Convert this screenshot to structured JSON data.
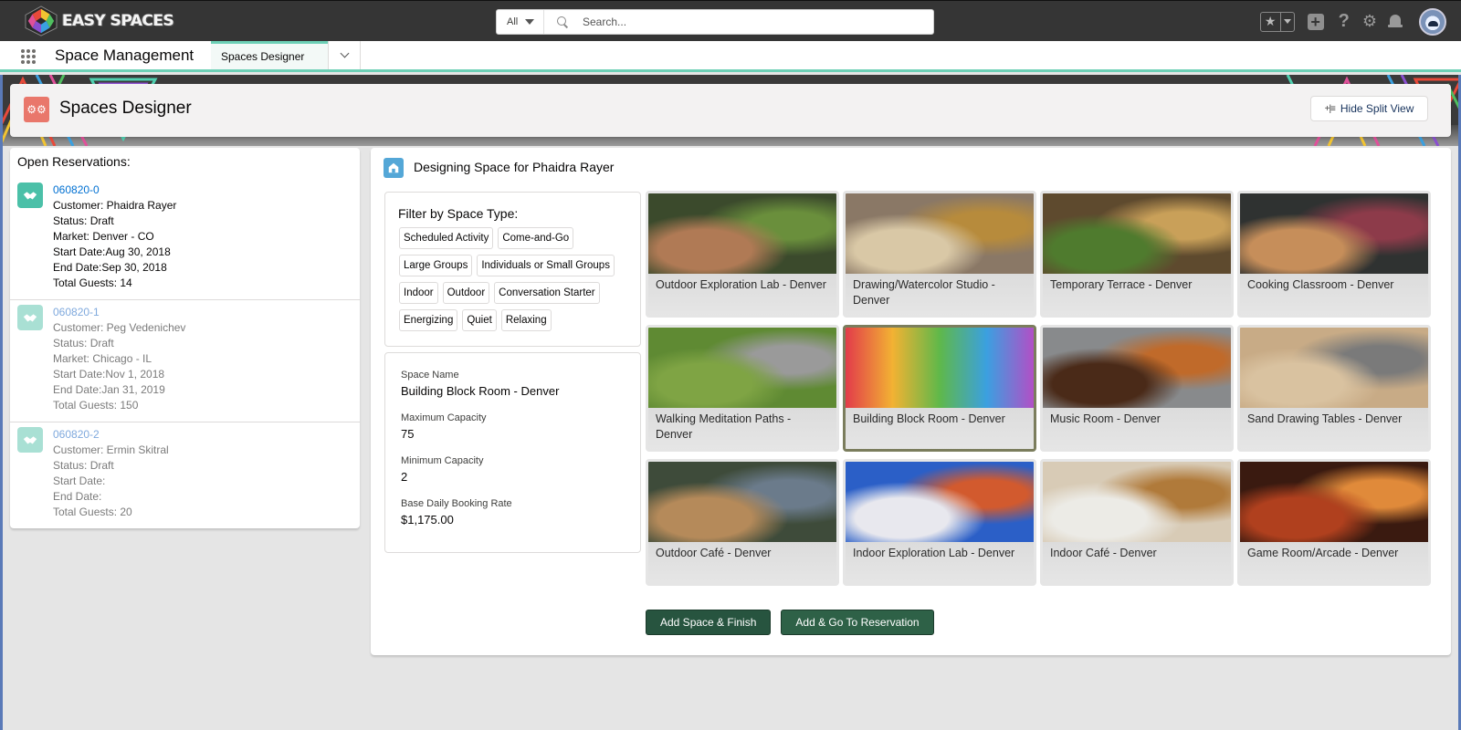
{
  "global_header": {
    "brand": "EASY SPACES",
    "search": {
      "scope": "All",
      "placeholder": "Search..."
    },
    "icons": [
      "favorites-star-icon",
      "favorites-dropdown-icon",
      "global-add-icon",
      "help-icon",
      "setup-gear-icon",
      "notifications-bell-icon",
      "user-avatar"
    ]
  },
  "app_nav": {
    "app_name": "Space Management",
    "tabs": [
      {
        "label": "Spaces Designer",
        "active": true
      }
    ]
  },
  "page_header": {
    "title": "Spaces Designer",
    "hide_split_view_label": "Hide Split View"
  },
  "reservations": {
    "title": "Open Reservations:",
    "items": [
      {
        "id": "060820-0",
        "customer": "Customer: Phaidra Rayer",
        "status": "Status: Draft",
        "market": "Market: Denver - CO",
        "start_date": "Start Date:Aug 30, 2018",
        "end_date": "End Date:Sep 30, 2018",
        "total_guests": "Total Guests: 14",
        "active": true
      },
      {
        "id": "060820-1",
        "customer": "Customer: Peg Vedenichev",
        "status": "Status: Draft",
        "market": "Market: Chicago - IL",
        "start_date": "Start Date:Nov 1, 2018",
        "end_date": "End Date:Jan 31, 2019",
        "total_guests": "Total Guests: 150",
        "active": false
      },
      {
        "id": "060820-2",
        "customer": "Customer: Ermin Skitral",
        "status": "Status: Draft",
        "start_date": "Start Date:",
        "end_date": "End Date:",
        "total_guests": "Total Guests: 20",
        "active": false
      }
    ]
  },
  "designer": {
    "title": "Designing Space for Phaidra Rayer",
    "filter": {
      "title": "Filter by Space Type:",
      "options": [
        "Scheduled Activity",
        "Come-and-Go",
        "Large Groups",
        "Individuals or Small Groups",
        "Indoor",
        "Outdoor",
        "Conversation Starter",
        "Energizing",
        "Quiet",
        "Relaxing"
      ]
    },
    "details": {
      "space_name_label": "Space Name",
      "space_name": "Building Block Room - Denver",
      "max_capacity_label": "Maximum Capacity",
      "max_capacity": "75",
      "min_capacity_label": "Minimum Capacity",
      "min_capacity": "2",
      "rate_label": "Base Daily Booking Rate",
      "rate": "$1,175.00"
    },
    "spaces": [
      {
        "name": "Outdoor Exploration Lab - Denver",
        "colors": [
          "#3b4a2c",
          "#b07a55",
          "#6a8f3c"
        ]
      },
      {
        "name": "Drawing/Watercolor Studio - Denver",
        "colors": [
          "#8a7866",
          "#d9c8a6",
          "#b78b3c"
        ]
      },
      {
        "name": "Temporary Terrace - Denver",
        "colors": [
          "#5e4a2e",
          "#4f7b2e",
          "#c9a059"
        ]
      },
      {
        "name": "Cooking Classroom - Denver",
        "colors": [
          "#2f3231",
          "#c68e5a",
          "#8d3b4a"
        ]
      },
      {
        "name": "Walking Meditation Paths - Denver",
        "colors": [
          "#5f8a33",
          "#7fa444",
          "#9a9a9a"
        ]
      },
      {
        "name": "Building Block Room - Denver",
        "colors": [
          "#e23b4a",
          "#f2b233",
          "#5fb84a",
          "#3ba0e0",
          "#b24fc6"
        ],
        "selected": true
      },
      {
        "name": "Music Room - Denver",
        "colors": [
          "#888a8c",
          "#4a2a18",
          "#c06a2a"
        ]
      },
      {
        "name": "Sand Drawing Tables - Denver",
        "colors": [
          "#c8ab86",
          "#d9c2a0",
          "#7a7a7a"
        ]
      },
      {
        "name": "Outdoor Café - Denver",
        "colors": [
          "#3e4b3a",
          "#b58a5a",
          "#6b7b8b"
        ]
      },
      {
        "name": "Indoor Exploration Lab - Denver",
        "colors": [
          "#2b5fc7",
          "#e8e8ee",
          "#d25a2e"
        ]
      },
      {
        "name": "Indoor Café - Denver",
        "colors": [
          "#d8cbb6",
          "#ecebe6",
          "#b07a3a"
        ]
      },
      {
        "name": "Game Room/Arcade - Denver",
        "colors": [
          "#3a1a10",
          "#b0401e",
          "#e08a3a"
        ]
      }
    ],
    "buttons": {
      "finish": "Add Space & Finish",
      "go_to_reservation": "Add & Go To Reservation"
    }
  }
}
